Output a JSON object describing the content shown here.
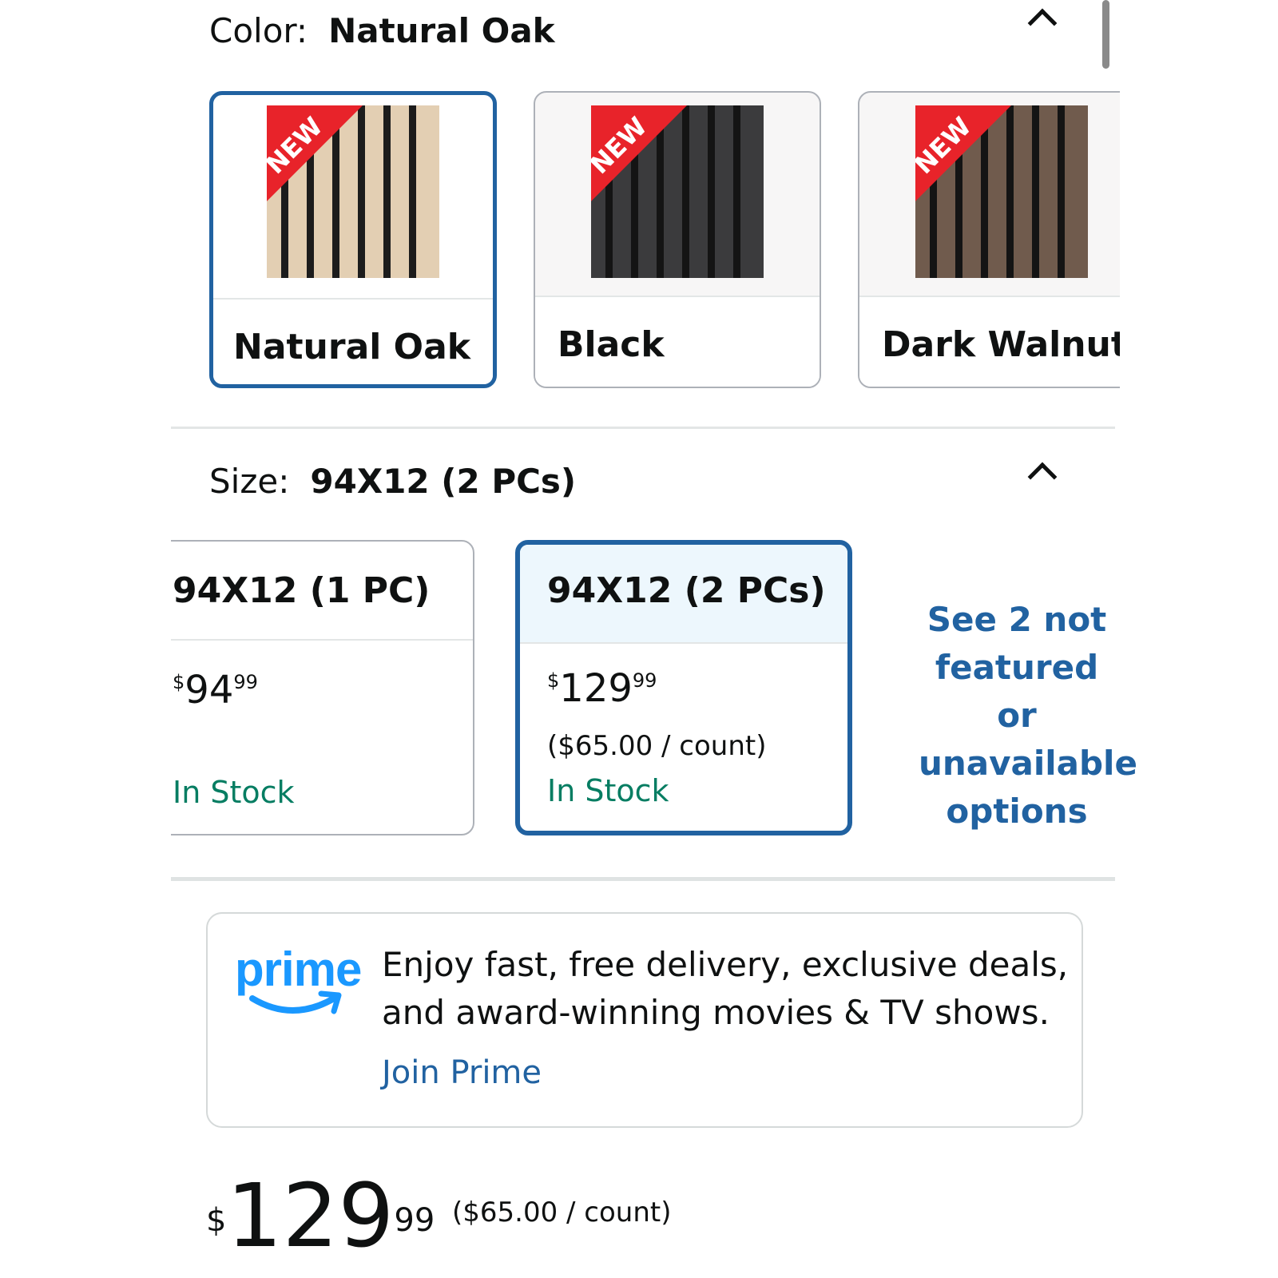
{
  "color": {
    "label": "Color:",
    "selected_value": "Natural Oak",
    "options": [
      {
        "name": "Natural Oak",
        "badge": "NEW",
        "wood": "#e3cfb3",
        "selected": true
      },
      {
        "name": "Black",
        "badge": "NEW",
        "wood": "#3b3b3d",
        "selected": false
      },
      {
        "name": "Dark Walnut",
        "badge": "NEW",
        "wood": "#705b4d",
        "selected": false
      }
    ]
  },
  "size": {
    "label": "Size:",
    "selected_value": "94X12 (2 PCs)",
    "options": [
      {
        "title": "94X12 (1 PC)",
        "currency": "$",
        "whole": "94",
        "cents": "99",
        "unit_price": "",
        "stock": "In Stock",
        "selected": false
      },
      {
        "title": "94X12 (2 PCs)",
        "currency": "$",
        "whole": "129",
        "cents": "99",
        "unit_price": "($65.00 / count)",
        "stock": "In Stock",
        "selected": true
      }
    ],
    "see_more": "See 2 not featured or unavailable options"
  },
  "prime": {
    "logo_text": "prime",
    "description": "Enjoy fast, free delivery, exclusive deals, and award-winning movies & TV shows.",
    "join_label": "Join Prime"
  },
  "price": {
    "currency": "$",
    "whole": "129",
    "cents": "99",
    "unit_price": "($65.00 / count)"
  },
  "colors": {
    "accent_blue": "#2162a1",
    "stock_green": "#067d62",
    "prime_blue": "#1a98ff",
    "badge_red": "#e8232a"
  }
}
